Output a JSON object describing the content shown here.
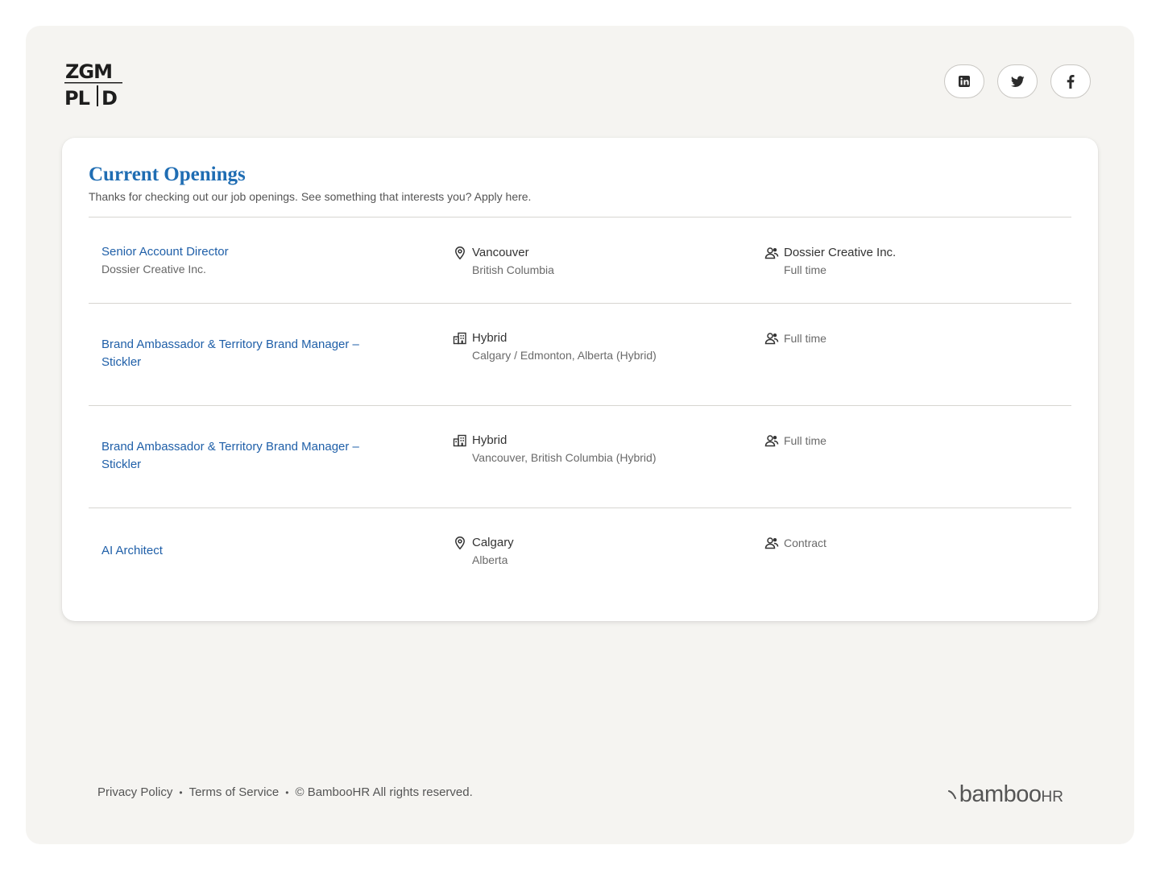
{
  "brand": {
    "logo_line1": "ZGM",
    "logo_line2": "PLD"
  },
  "social": [
    {
      "name": "linkedin-icon"
    },
    {
      "name": "twitter-icon"
    },
    {
      "name": "facebook-icon"
    }
  ],
  "openings": {
    "title": "Current Openings",
    "subtitle": "Thanks for checking out our job openings. See something that interests you? Apply here.",
    "jobs": [
      {
        "title": "Senior Account Director",
        "company": "Dossier Creative Inc.",
        "location_icon": "map-pin-icon",
        "location_main": "Vancouver",
        "location_sub": "British Columbia",
        "type_main": "Dossier Creative Inc.",
        "type_sub": "Full time"
      },
      {
        "title": "Brand Ambassador & Territory Brand Manager – Stickler",
        "company": "",
        "location_icon": "building-icon",
        "location_main": "Hybrid",
        "location_sub": "Calgary / Edmonton, Alberta (Hybrid)",
        "type_main": "Full time",
        "type_sub": ""
      },
      {
        "title": "Brand Ambassador & Territory Brand Manager – Stickler",
        "company": "",
        "location_icon": "building-icon",
        "location_main": "Hybrid",
        "location_sub": "Vancouver, British Columbia (Hybrid)",
        "type_main": "Full time",
        "type_sub": ""
      },
      {
        "title": "AI Architect",
        "company": "",
        "location_icon": "map-pin-icon",
        "location_main": "Calgary",
        "location_sub": "Alberta",
        "type_main": "Contract",
        "type_sub": ""
      }
    ]
  },
  "footer": {
    "privacy": "Privacy Policy",
    "terms": "Terms of Service",
    "copyright": "© BambooHR All rights reserved.",
    "separator": "•",
    "brand_main": "bamboo",
    "brand_suffix": "HR"
  },
  "colors": {
    "accent": "#1f6db3",
    "link": "#1f5fa8",
    "page_bg": "#f5f4f1"
  }
}
